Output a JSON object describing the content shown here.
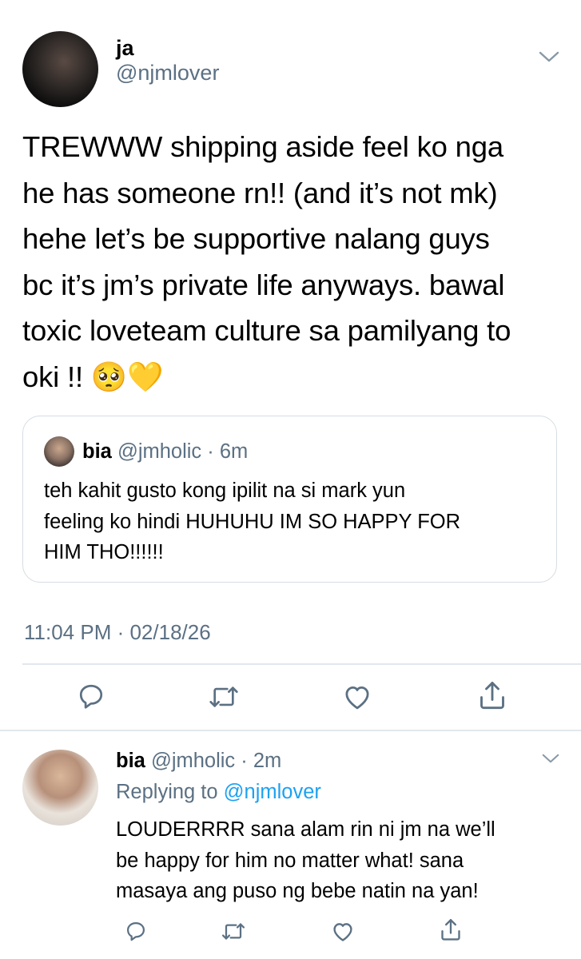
{
  "main_tweet": {
    "display_name": "ja",
    "handle": "@njmlover",
    "text_lines": [
      "TREWWW shipping aside feel ko nga",
      "he has someone rn!! (and it’s not mk)",
      "hehe let’s be supportive nalang guys",
      "bc it’s jm’s private life anyways. bawal",
      "toxic loveteam culture sa pamilyang to",
      "oki !! 🥺💛"
    ],
    "timestamp": "11:04 PM · 02/18/26",
    "actions": [
      "reply-icon",
      "retweet-icon",
      "like-icon",
      "share-icon"
    ]
  },
  "quoted_tweet": {
    "display_name": "bia",
    "handle_time": "@jmholic · 6m",
    "text_lines": [
      "teh kahit gusto kong ipilit na si mark yun",
      "feeling ko hindi HUHUHU IM SO HAPPY FOR",
      "HIM THO!!!!!!"
    ]
  },
  "reply_tweet": {
    "display_name": "bia",
    "handle_time": "@jmholic · 2m",
    "replying_prefix": "Replying to",
    "replying_to": "@njmlover",
    "text_lines": [
      "LOUDERRRR sana alam rin ni jm na we’ll",
      "be happy for him no matter what! sana",
      "masaya ang puso ng bebe natin na yan!"
    ]
  },
  "colors": {
    "text": "#000000",
    "secondary": "#5b7083",
    "link": "#1da1f2",
    "border": "#d6dde3"
  }
}
